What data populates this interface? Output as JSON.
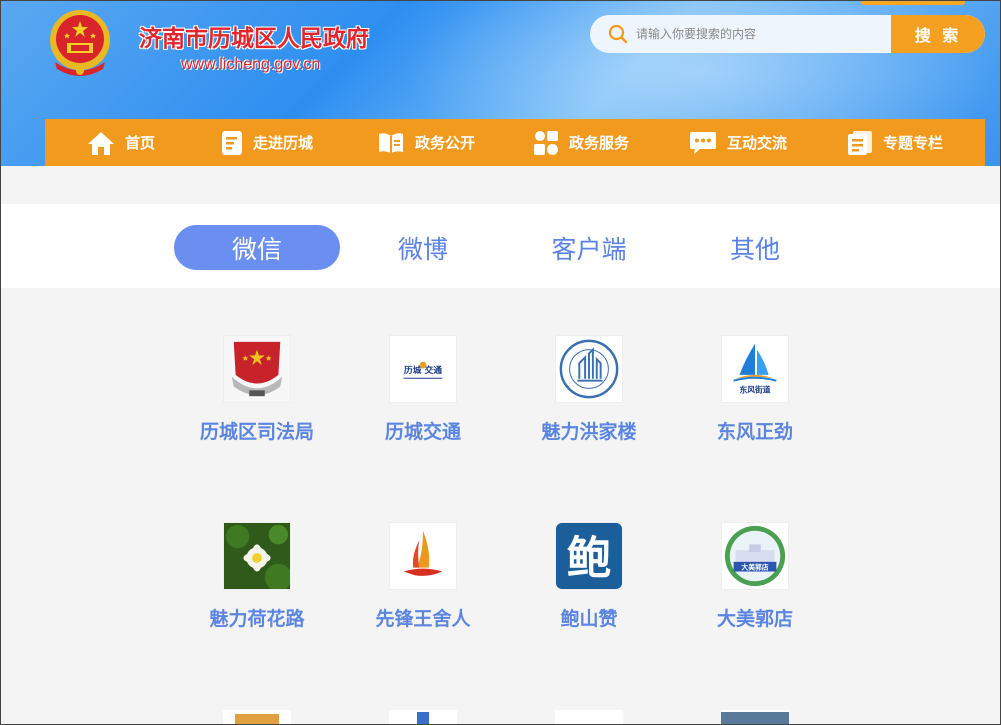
{
  "header": {
    "site_title": "济南市历城区人民政府",
    "site_url": "www.licheng.gov.cn",
    "search_placeholder": "请输入你要搜索的内容",
    "search_button": "搜 索"
  },
  "nav": {
    "items": [
      {
        "label": "首页",
        "icon": "home-icon"
      },
      {
        "label": "走进历城",
        "icon": "document-icon"
      },
      {
        "label": "政务公开",
        "icon": "open-book-icon"
      },
      {
        "label": "政务服务",
        "icon": "grid-service-icon"
      },
      {
        "label": "互动交流",
        "icon": "chat-icon"
      },
      {
        "label": "专题专栏",
        "icon": "columns-icon"
      }
    ]
  },
  "tabs": [
    {
      "label": "微信",
      "active": true
    },
    {
      "label": "微博",
      "active": false
    },
    {
      "label": "客户端",
      "active": false
    },
    {
      "label": "其他",
      "active": false
    }
  ],
  "accounts": [
    {
      "label": "历城区司法局",
      "logo_text": ""
    },
    {
      "label": "历城交通",
      "logo_text": "历城 交通"
    },
    {
      "label": "魅力洪家楼",
      "logo_text": ""
    },
    {
      "label": "东风正劲",
      "logo_text": "东风街道"
    },
    {
      "label": "魅力荷花路",
      "logo_text": ""
    },
    {
      "label": "先锋王舍人",
      "logo_text": ""
    },
    {
      "label": "鲍山赞",
      "logo_text": "鲍"
    },
    {
      "label": "大美郭店",
      "logo_text": "大美郭店"
    }
  ],
  "colors": {
    "accent_orange": "#f29a1d",
    "tab_blue": "#6a8ff0",
    "label_blue": "#5b85e0",
    "title_red": "#e3262d"
  }
}
